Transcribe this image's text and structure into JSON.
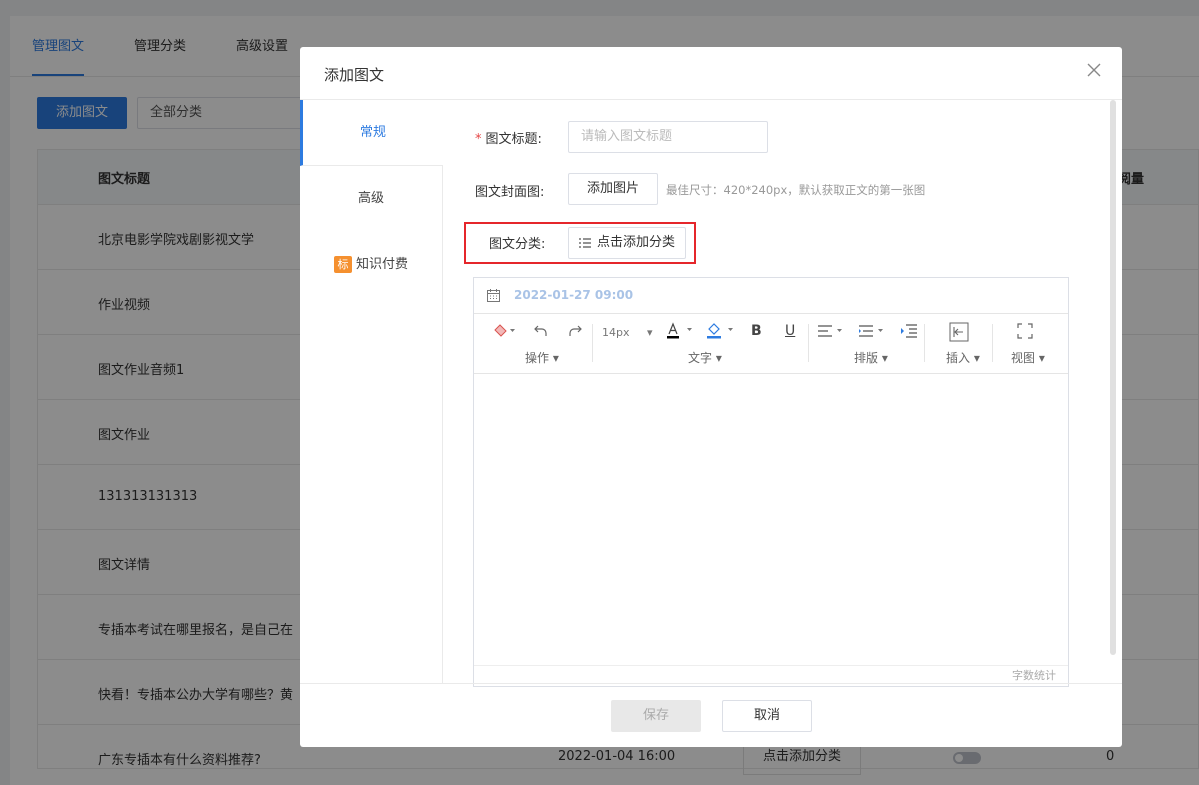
{
  "bg": {
    "tabs": [
      "管理图文",
      "管理分类",
      "高级设置"
    ],
    "add_button": "添加图文",
    "category_select": "全部分类",
    "col_title": "图文标题",
    "col_read": "阅量",
    "rows": [
      {
        "title": "北京电影学院戏剧影视文学"
      },
      {
        "title": "作业视频"
      },
      {
        "title": "图文作业音频1"
      },
      {
        "title": "图文作业"
      },
      {
        "title": "131313131313"
      },
      {
        "title": "图文详情"
      },
      {
        "title": "专插本考试在哪里报名，是自己在"
      },
      {
        "title": "快看！专插本公办大学有哪些？黄"
      },
      {
        "title": "广东专插本有什么资料推荐?",
        "date": "2022-01-04 16:00",
        "category": "点击添加分类",
        "count": "0"
      }
    ]
  },
  "modal": {
    "title": "添加图文",
    "sidebar": [
      {
        "label": "常规"
      },
      {
        "label": "高级"
      },
      {
        "label": "知识付费",
        "tag": "标"
      }
    ],
    "form": {
      "title_label": "图文标题:",
      "title_required": "*",
      "title_placeholder": "请输入图文标题",
      "cover_label": "图文封面图:",
      "cover_button": "添加图片",
      "cover_hint": "最佳尺寸：420*240px，默认获取正文的第一张图",
      "category_label": "图文分类:",
      "category_button": "点击添加分类"
    },
    "editor": {
      "date": "2022-01-27 09:00",
      "font_size": "14px",
      "groups": [
        "操作",
        "文字",
        "排版",
        "插入",
        "视图"
      ],
      "word_count": "字数统计"
    },
    "footer": {
      "save": "保存",
      "cancel": "取消"
    }
  }
}
